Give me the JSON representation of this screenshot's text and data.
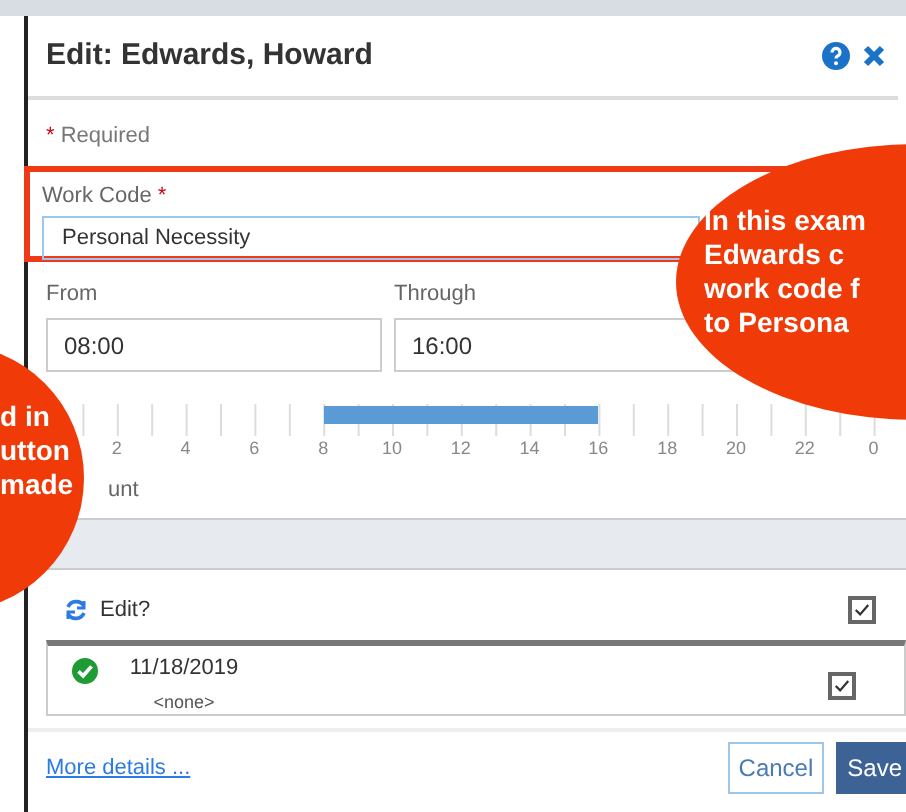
{
  "dialog": {
    "title": "Edit: Edwards, Howard",
    "required_marker": "*",
    "required_note": "Required",
    "work_code": {
      "label": "Work Code",
      "required_marker": "*",
      "value": "Personal Necessity",
      "highlighted": true
    },
    "from": {
      "label": "From",
      "value": "08:00"
    },
    "through": {
      "label": "Through",
      "value": "16:00"
    },
    "timeline": {
      "ticks": [
        {
          "label": "2",
          "shaded": false
        },
        {
          "label": "4",
          "shaded": false
        },
        {
          "label": "6",
          "shaded": false
        },
        {
          "label": "8",
          "shaded": true
        },
        {
          "label": "10",
          "shaded": true
        },
        {
          "label": "12",
          "shaded": true
        },
        {
          "label": "14",
          "shaded": true
        },
        {
          "label": "16",
          "shaded": false
        },
        {
          "label": "18",
          "shaded": false
        },
        {
          "label": "20",
          "shaded": false
        },
        {
          "label": "22",
          "shaded": false
        },
        {
          "label": "0",
          "shaded": false
        }
      ]
    },
    "amount_label": "unt",
    "edit_row": {
      "label": "Edit?",
      "checked": true
    },
    "entries": [
      {
        "date": "11/18/2019",
        "note": "<none>",
        "checked": true
      }
    ],
    "more_details": "More details ...",
    "buttons": [
      {
        "label": "Cancel",
        "kind": "secondary"
      },
      {
        "label": "Save",
        "kind": "primary"
      }
    ]
  },
  "callouts": [
    {
      "kind": "left",
      "lines": [
        "d in",
        "utton",
        "made"
      ]
    },
    {
      "kind": "right",
      "lines": [
        "In this exam",
        "Edwards c",
        "work code f",
        "to Persona"
      ]
    }
  ]
}
